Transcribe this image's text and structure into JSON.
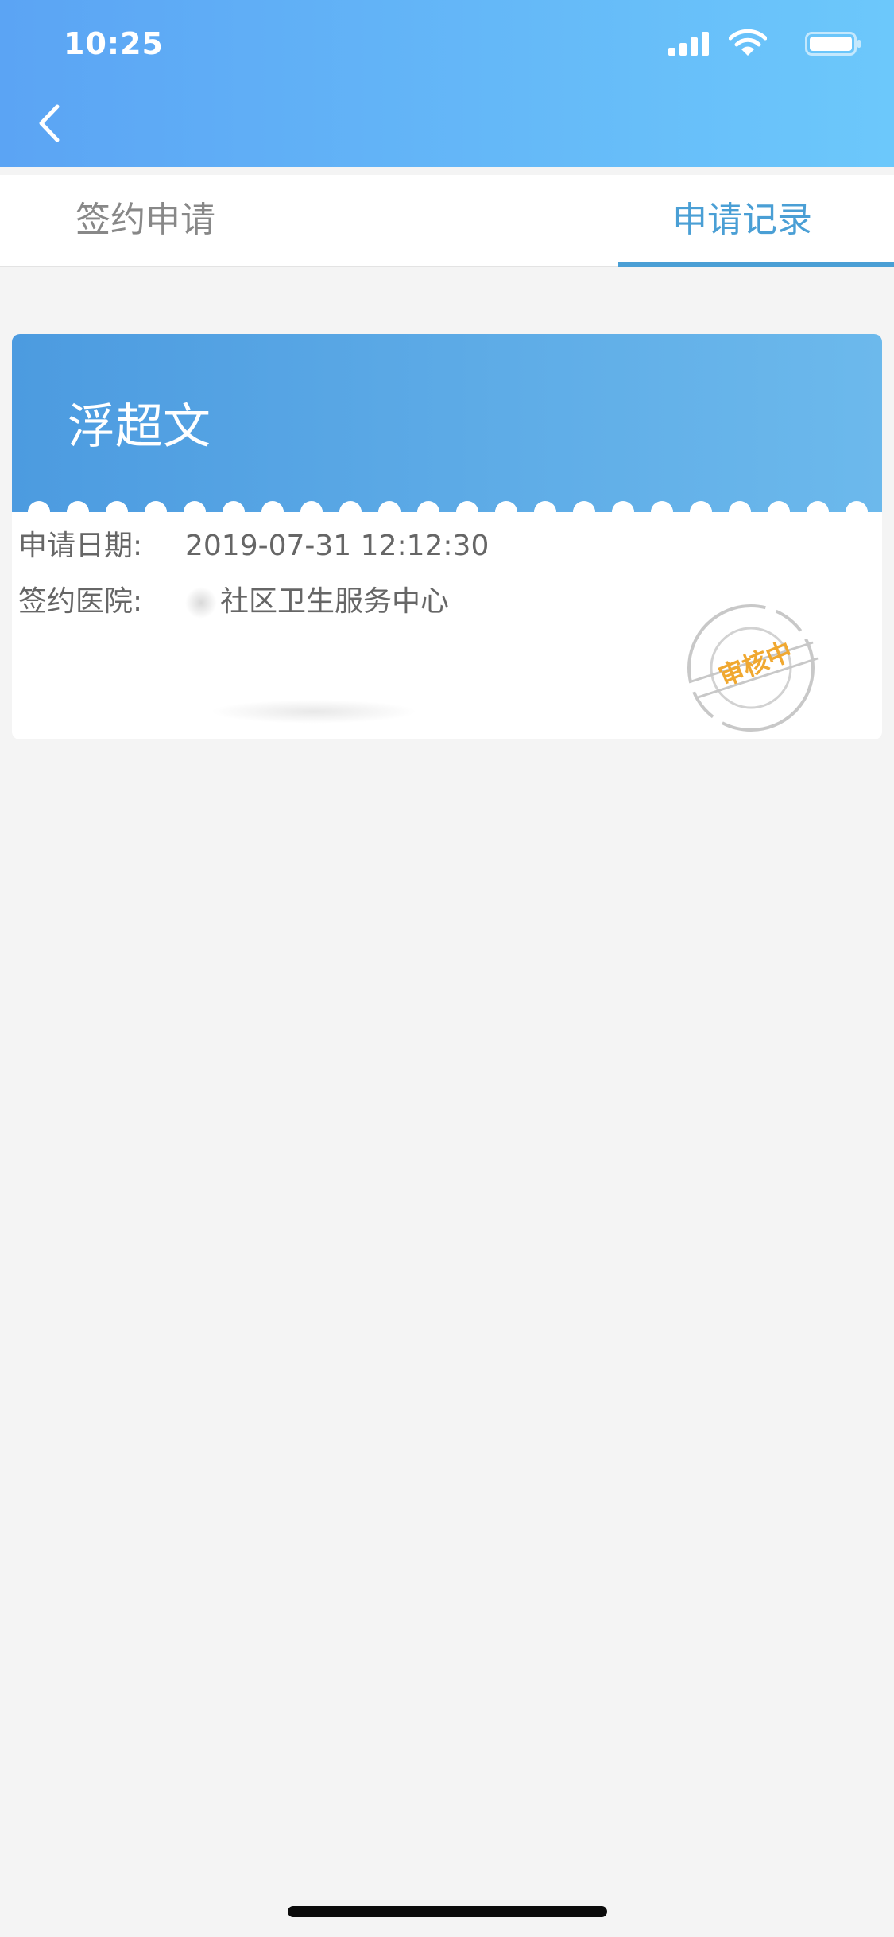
{
  "status_bar": {
    "time": "10:25",
    "icons": [
      "signal-icon",
      "wifi-icon",
      "battery-icon"
    ]
  },
  "nav": {
    "back_icon": "chevron-left-icon"
  },
  "tabs": [
    {
      "label": "签约申请",
      "active": false
    },
    {
      "label": "申请记录",
      "active": true
    }
  ],
  "record_card": {
    "name": "浮超文",
    "date_label": "申请日期:",
    "date_value": "2019-07-31 12:12:30",
    "hospital_label": "签约医院:",
    "hospital_value": "社区卫生服务中心",
    "status_stamp": "审核中"
  },
  "colors": {
    "header_start": "#5ba4f4",
    "header_end": "#6cc8fb",
    "accent": "#4a9fd5",
    "stamp": "#f0a830",
    "background": "#f4f4f4"
  }
}
